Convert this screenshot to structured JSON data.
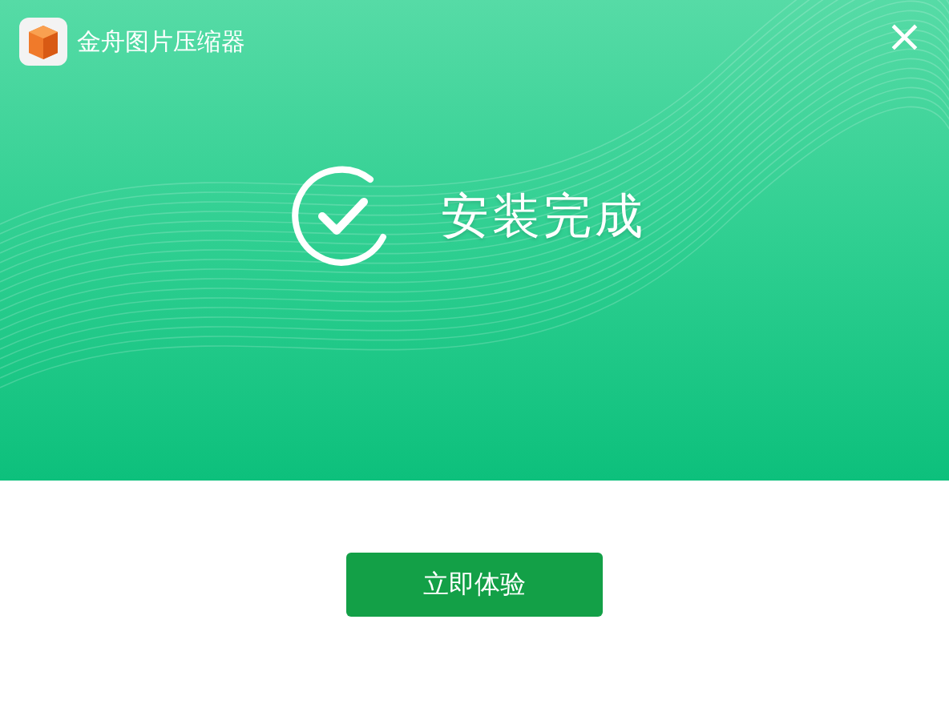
{
  "window": {
    "title": "金舟图片压缩器",
    "close": "×"
  },
  "status": {
    "message": "安装完成"
  },
  "action": {
    "label": "立即体验"
  }
}
